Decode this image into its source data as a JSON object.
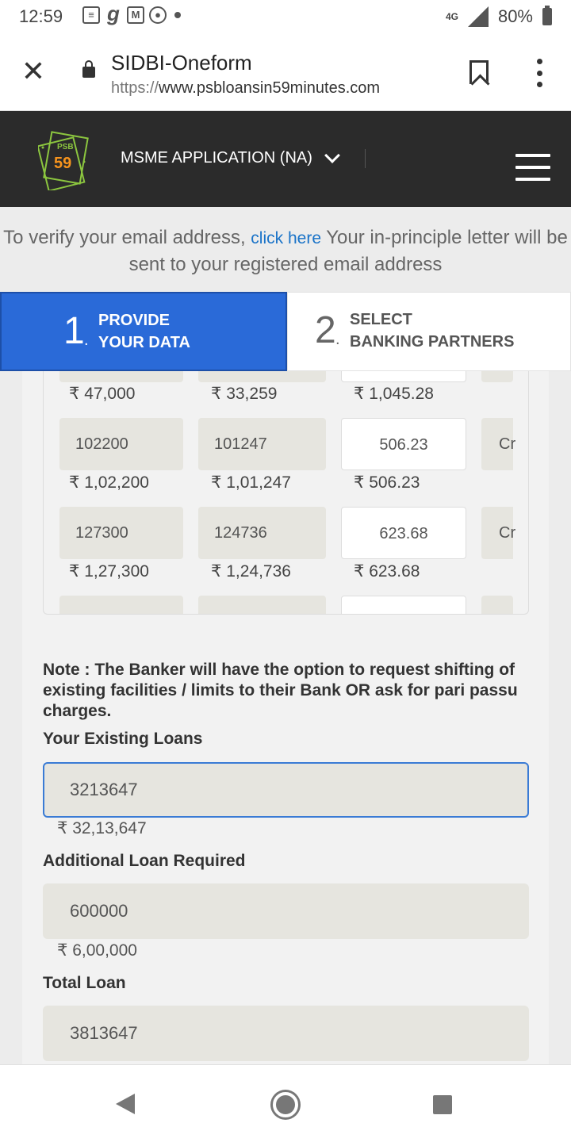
{
  "status_bar": {
    "time": "12:59",
    "network": "4G",
    "battery": "80%"
  },
  "browser": {
    "page_title": "SIDBI-Oneform",
    "url_scheme": "https://",
    "url_host": "www.psbloansin59minutes.com"
  },
  "site_header": {
    "logo_top": "PSB",
    "logo_number": "59",
    "app_selector": "MSME APPLICATION (NA)"
  },
  "verify": {
    "prefix": "To verify your email address,",
    "link": "click here",
    "suffix": "Your in-principle letter will be sent to your registered email address"
  },
  "steps": [
    {
      "number": "1",
      "line1": "PROVIDE",
      "line2": "YOUR DATA"
    },
    {
      "number": "2",
      "line1": "SELECT",
      "line2": "BANKING PARTNERS"
    }
  ],
  "table": {
    "top_row": {
      "c1": "₹ 47,000",
      "c2": "₹ 33,259",
      "c3": "₹ 1,045.28"
    },
    "rows": [
      {
        "c1": "102200",
        "c1_fmt": "₹ 1,02,200",
        "c2": "101247",
        "c2_fmt": "₹ 1,01,247",
        "c3": "506.23",
        "c3_fmt": "₹ 506.23",
        "c4": "Cr"
      },
      {
        "c1": "127300",
        "c1_fmt": "₹ 1,27,300",
        "c2": "124736",
        "c2_fmt": "₹ 1,24,736",
        "c3": "623.68",
        "c3_fmt": "₹ 623.68",
        "c4": "Cr"
      }
    ]
  },
  "form": {
    "note": "Note : The Banker will have the option to request shifting of existing facilities / limits to their Bank OR ask for pari passu charges.",
    "existing_loans_label": "Your Existing Loans",
    "existing_loans_value": "3213647",
    "existing_loans_fmt": "₹ 32,13,647",
    "additional_label": "Additional Loan Required",
    "additional_value": "600000",
    "additional_fmt": "₹ 6,00,000",
    "total_label": "Total Loan",
    "total_value": "3813647"
  },
  "colors": {
    "header_bg": "#2b2b2b",
    "step_active": "#2a6ad8",
    "link": "#1a73c8",
    "field_bg": "#e6e5df"
  }
}
